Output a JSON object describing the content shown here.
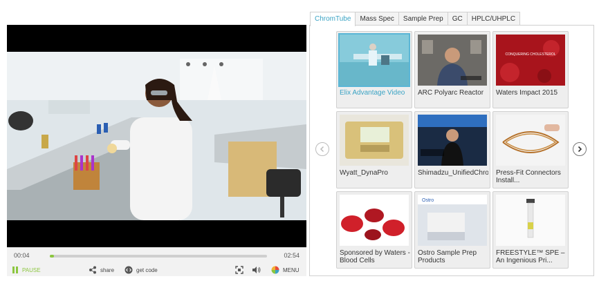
{
  "player": {
    "current_time": "00:04",
    "duration": "02:54",
    "progress_fraction": 0.02,
    "pause_label": "PAUSE",
    "share_label": "share",
    "code_label": "get code",
    "menu_label": "MENU",
    "accent_color": "#8cc63f"
  },
  "tabs": [
    {
      "label": "ChromTube",
      "active": true
    },
    {
      "label": "Mass Spec",
      "active": false
    },
    {
      "label": "Sample Prep",
      "active": false
    },
    {
      "label": "GC",
      "active": false
    },
    {
      "label": "HPLC/UHPLC",
      "active": false
    }
  ],
  "videos": [
    {
      "title": "Elix Advantage Video",
      "active": true
    },
    {
      "title": "ARC Polyarc Reactor",
      "active": false
    },
    {
      "title": "Waters Impact 2015",
      "thumb_text": "CONQUERING CHOLESTEROL",
      "active": false
    },
    {
      "title": "Wyatt_DynaPro",
      "active": false
    },
    {
      "title": "Shimadzu_UnifiedChromatography",
      "active": false
    },
    {
      "title": "Press-Fit Connectors Install...",
      "active": false
    },
    {
      "title": "Sponsored by Waters - Blood Cells",
      "active": false
    },
    {
      "title": "Ostro Sample Prep Products",
      "thumb_text": "Ostro",
      "active": false
    },
    {
      "title": "FREESTYLE™ SPE – An Ingenious Pri...",
      "active": false
    }
  ],
  "colors": {
    "active_tab": "#3aa3c4",
    "active_card_border": "#5bb6d6"
  }
}
